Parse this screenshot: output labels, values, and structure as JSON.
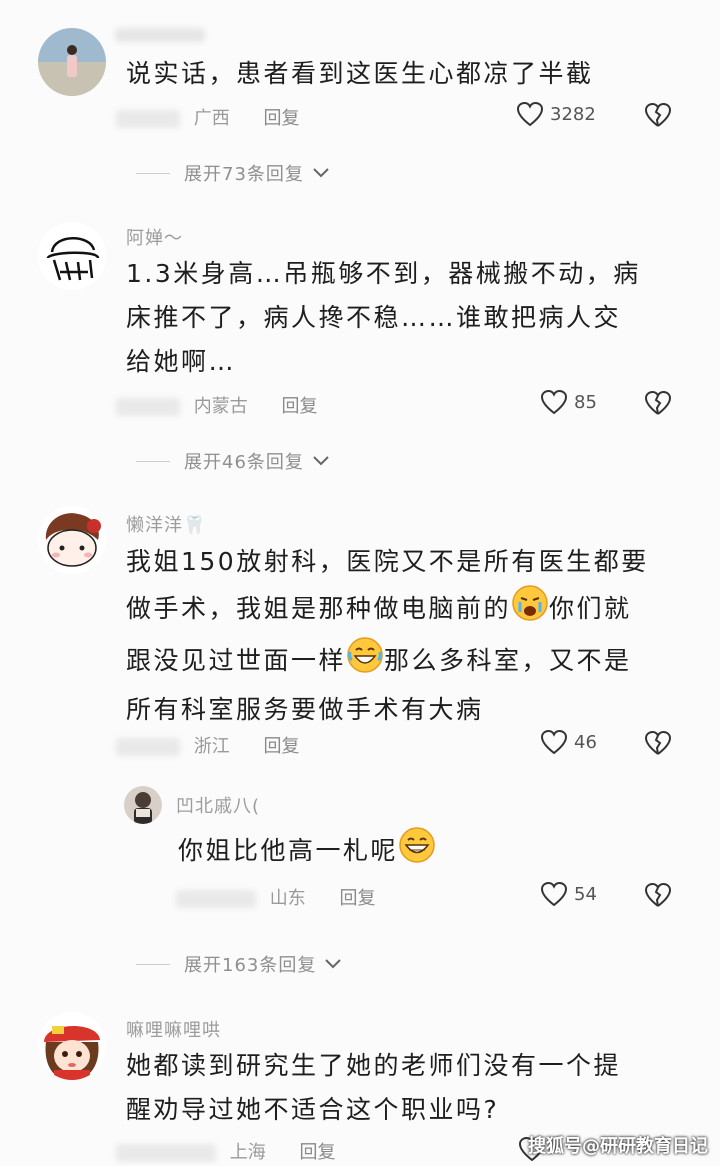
{
  "comments": [
    {
      "text": "说实话，患者看到这医生心都凉了半截",
      "location": "广西",
      "reply_label": "回复",
      "likes": "3282",
      "expand_label": "展开73条回复"
    },
    {
      "username": "阿婵～",
      "text_lines": [
        "1.3米身高…吊瓶够不到，器械搬不动，病",
        "床推不了，病人搀不稳……谁敢把病人交",
        "给她啊…"
      ],
      "location": "内蒙古",
      "reply_label": "回复",
      "likes": "85",
      "expand_label": "展开46条回复"
    },
    {
      "username": "懒洋洋🦷",
      "text_lines": [
        "我姐150放射科，医院又不是所有医生都要",
        "做手术，我姐是那种做电脑前的",
        "你们就",
        "跟没见过世面一样",
        "那么多科室，又不是",
        "所有科室服务要做手术有大病"
      ],
      "location": "浙江",
      "reply_label": "回复",
      "likes": "46"
    },
    {
      "username": "凹北戚八(",
      "text": "你姐比他高一札呢",
      "location": "山东",
      "reply_label": "回复",
      "likes": "54",
      "expand_label": "展开163条回复"
    },
    {
      "username": "嘛哩嘛哩哄",
      "text_lines": [
        "她都读到研究生了她的老师们没有一个提",
        "醒劝导过她不适合这个职业吗?"
      ],
      "location": "上海",
      "reply_label": "回复"
    }
  ],
  "watermark": "搜狐号@研研教育日记",
  "icons": {
    "like": "heart-outline-icon",
    "dislike": "broken-heart-icon",
    "expand": "chevron-down-icon"
  },
  "colors": {
    "text": "#1e1e1e",
    "muted": "#9a9a9a",
    "background": "#fbfbfb"
  }
}
